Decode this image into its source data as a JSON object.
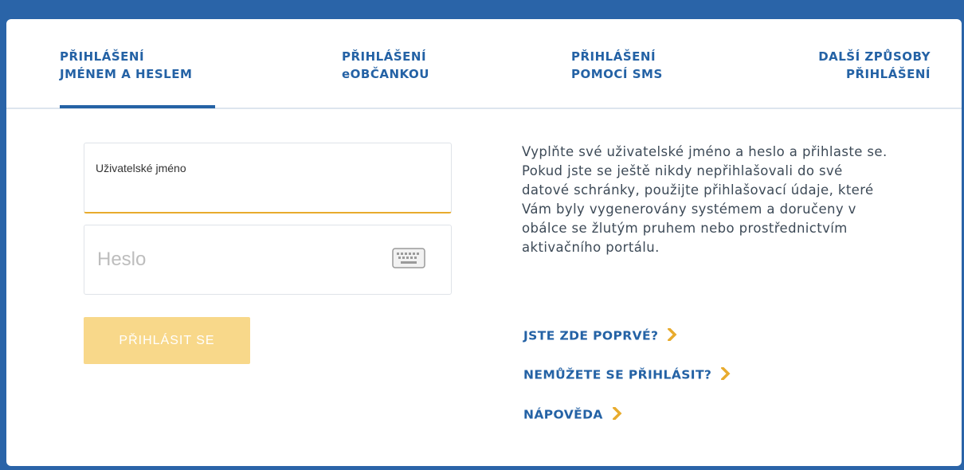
{
  "tabs": [
    {
      "line1": "PŘIHLÁŠENÍ",
      "line2": "JMÉNEM A HESLEM",
      "active": true
    },
    {
      "line1": "PŘIHLÁŠENÍ",
      "line2": "eOBČANKOU",
      "active": false
    },
    {
      "line1": "PŘIHLÁŠENÍ",
      "line2": "POMOCÍ SMS",
      "active": false
    },
    {
      "line1": "DALŠÍ ZPŮSOBY",
      "line2": "PŘIHLÁŠENÍ",
      "active": false
    }
  ],
  "form": {
    "username_label": "Uživatelské jméno",
    "username_value": "",
    "password_placeholder": "Heslo",
    "password_value": "",
    "keyboard_icon": "keyboard-icon",
    "submit_label": "PŘIHLÁSIT SE"
  },
  "info_text": "Vyplňte své uživatelské jméno a heslo a přihlaste se. Pokud jste se ještě nikdy nepřihlašovali do své datové schránky, použijte přihlašovací údaje, které Vám byly vygenerovány systémem a doručeny v obálce se žlutým pruhem nebo prostřednictvím aktivačního portálu.",
  "links": [
    {
      "label": "JSTE ZDE POPRVÉ?",
      "icon": "chevron-right-icon"
    },
    {
      "label": "NEMŮŽETE SE PŘIHLÁSIT?",
      "icon": "chevron-right-icon"
    },
    {
      "label": "NÁPOVĚDA",
      "icon": "chevron-right-icon"
    }
  ],
  "colors": {
    "background": "#2a64a8",
    "primary": "#2462a5",
    "accent": "#e8ab2d",
    "button_disabled": "#f8d88a",
    "text": "#3d4a57"
  }
}
